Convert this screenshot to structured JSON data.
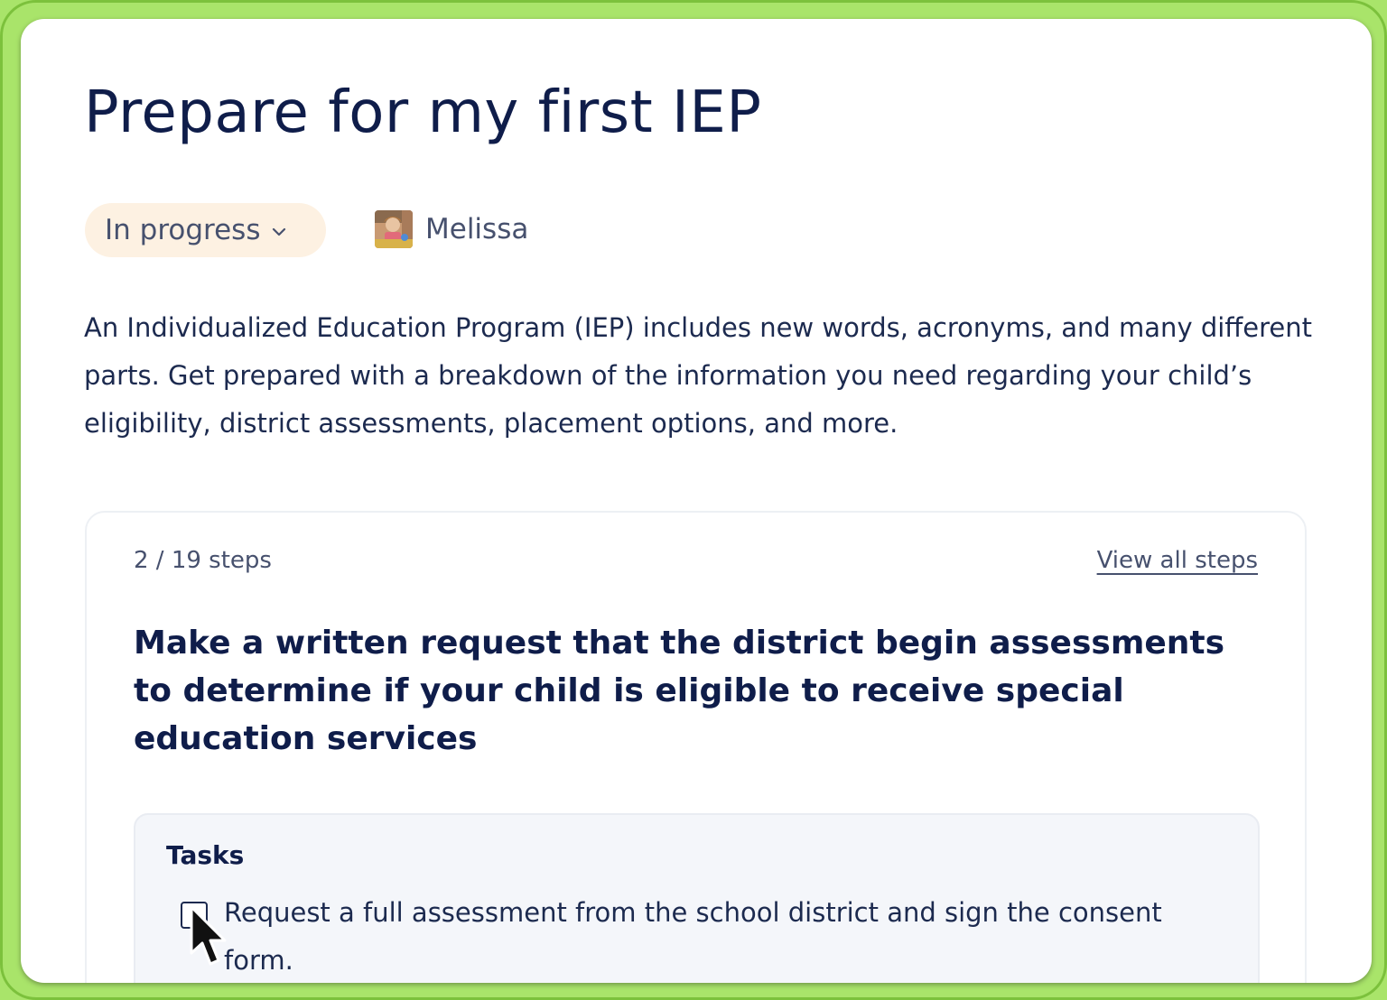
{
  "page": {
    "title": "Prepare for my first IEP"
  },
  "status": {
    "label": "In progress",
    "icon": "chevron-down-icon"
  },
  "owner": {
    "name": "Melissa",
    "avatar_icon": "child-photo-avatar"
  },
  "description": "An Individualized Education Program (IEP) includes new words, acronyms, and many different parts. Get prepared with a breakdown of the information you need regarding your child’s eligibility, district assessments, placement options, and more.",
  "step_card": {
    "progress_text": "2 / 19 steps",
    "progress": {
      "current": 2,
      "total": 19
    },
    "view_all_label": "View all steps",
    "step_title": "Make a written request that the district begin assessments to determine if your child is eligible to receive special education services",
    "tasks": {
      "heading": "Tasks",
      "items": [
        {
          "label": "Request a full assessment from the school district and sign the consent form.",
          "checked": false
        }
      ]
    }
  },
  "colors": {
    "frame": "#a9e46a",
    "text_dark": "#0f1d4a",
    "text_muted": "#47516e",
    "status_pill_bg": "#fdf1e2",
    "tasks_bg": "#f4f6fa"
  }
}
